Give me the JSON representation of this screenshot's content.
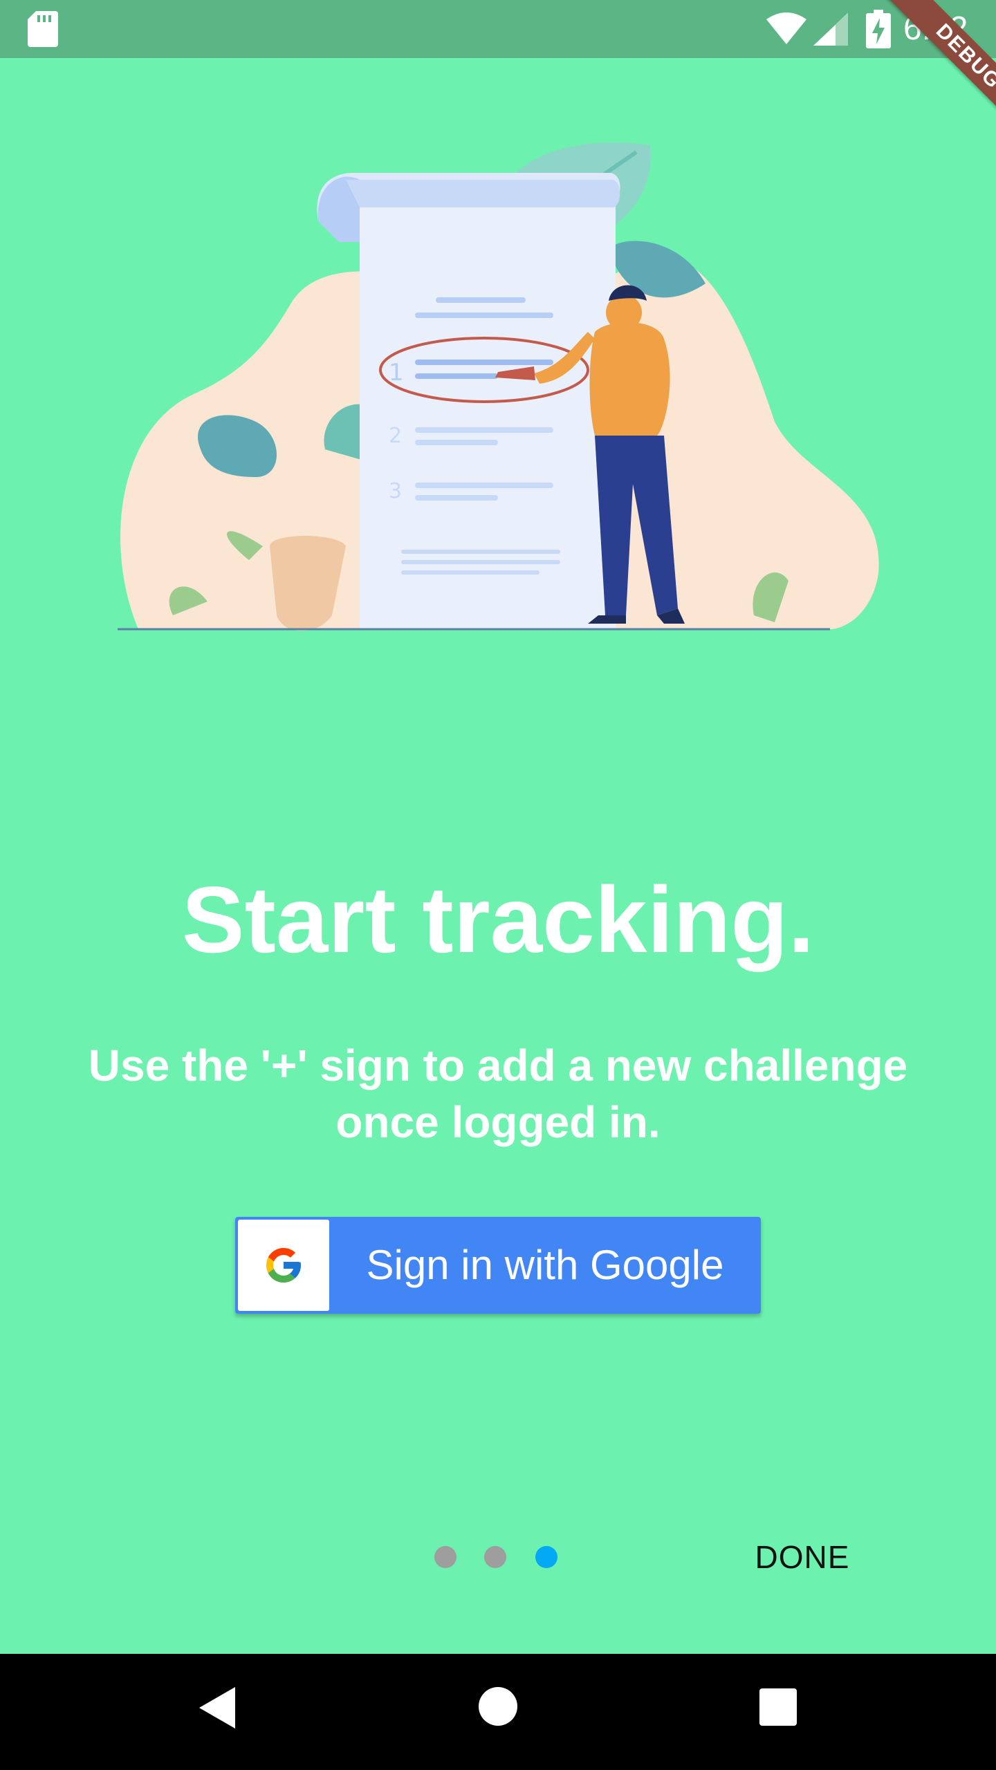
{
  "status_bar": {
    "time": "6:02",
    "icons": [
      "sd-card-icon",
      "wifi-icon",
      "cell-signal-icon",
      "battery-charging-icon"
    ]
  },
  "debug_banner": {
    "label": "DEBUG"
  },
  "onboarding": {
    "illustration": "checklist-person-illustration",
    "headline": "Start tracking.",
    "subtitle": "Use the '+' sign to add a new challenge once logged in.",
    "google_button": {
      "label": "Sign in with Google",
      "icon": "google-g-icon"
    },
    "pager": {
      "total": 3,
      "active_index": 2
    },
    "done_label": "DONE"
  },
  "nav_bar": {
    "icons": [
      "back-icon",
      "home-icon",
      "recents-icon"
    ]
  },
  "colors": {
    "background": "#6cf1ae",
    "status_bar": "#5bb585",
    "google_blue": "#4285f4",
    "dot_inactive": "#9e9e9e",
    "dot_active": "#03a9f4",
    "debug_banner": "#8b4a3b"
  }
}
